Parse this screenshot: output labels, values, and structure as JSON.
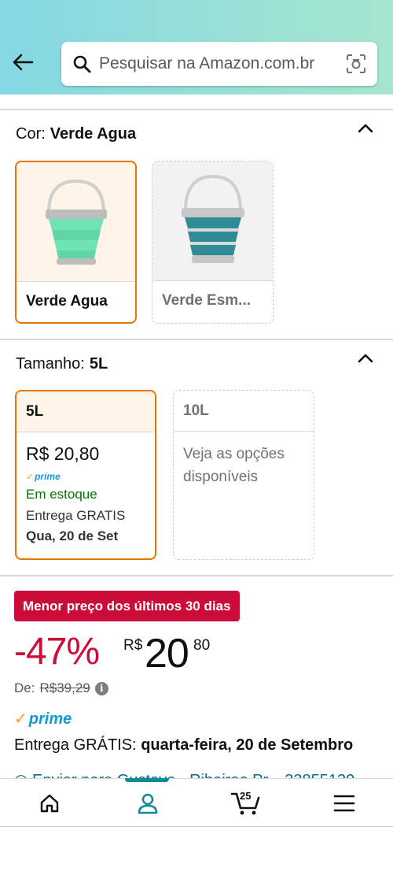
{
  "header": {
    "search_placeholder": "Pesquisar na Amazon.com.br"
  },
  "color_section": {
    "label": "Cor:",
    "selected_value": "Verde Agua",
    "options": [
      {
        "label": "Verde Agua",
        "selected": true,
        "color": "#6fe3b4"
      },
      {
        "label": "Verde Esm...",
        "selected": false,
        "color": "#2f8c97"
      }
    ]
  },
  "size_section": {
    "label": "Tamanho:",
    "selected_value": "5L",
    "options": [
      {
        "label": "5L",
        "selected": true,
        "price": "R$ 20,80",
        "prime": "prime",
        "stock": "Em estoque",
        "delivery_line1": "Entrega GRATIS",
        "delivery_line2": "Qua, 20 de Set"
      },
      {
        "label": "10L",
        "selected": false,
        "unavailable_text": "Veja as opções disponíveis"
      }
    ]
  },
  "deal": {
    "badge": "Menor preço dos últimos 30 dias",
    "discount": "-47%",
    "currency": "R$",
    "price_whole": "20",
    "price_fraction": "80",
    "list_price_label": "De:",
    "list_price": "R$39,29",
    "prime": "prime",
    "delivery_label": "Entrega GRÁTIS:",
    "delivery_date": "quarta-feira, 20 de Setembro",
    "location": "Enviar para Gustavo - Ribeirao Pr... 33855130"
  },
  "bottom_nav": {
    "cart_count": "25",
    "items": [
      "home-icon",
      "account-icon",
      "cart-icon",
      "menu-icon"
    ]
  },
  "colors": {
    "accent_orange": "#e77600",
    "deal_red": "#cc0c39",
    "prime_blue": "#1399d6",
    "in_stock_green": "#007600",
    "nav_teal": "#0e8a99"
  }
}
